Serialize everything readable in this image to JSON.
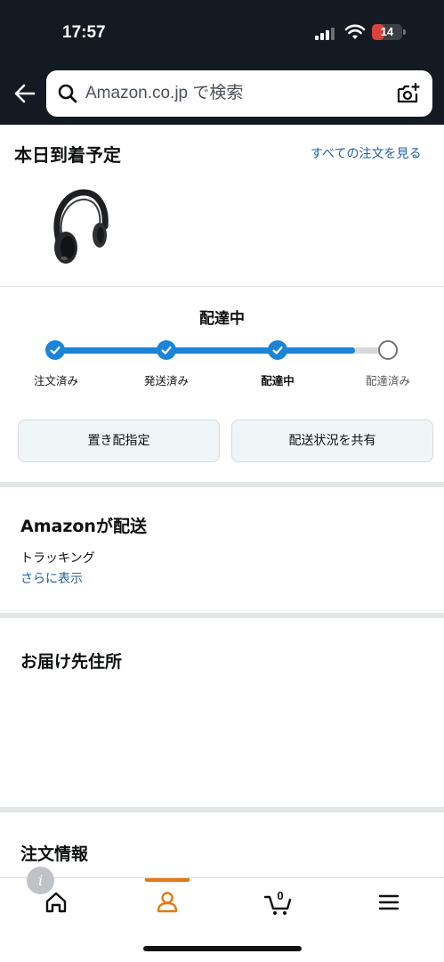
{
  "status_bar": {
    "time": "17:57",
    "battery": "14",
    "battery_level": 0.14
  },
  "search": {
    "placeholder": "Amazon.co.jp で検索",
    "value": "Amazon.co.jp で検索"
  },
  "arrival": {
    "title": "本日到着予定",
    "view_all_link": "すべての注文を見る"
  },
  "product": {
    "image_icon": "headphones-image"
  },
  "tracking": {
    "status": "配達中",
    "progress": 0.9,
    "steps": [
      {
        "label": "注文済み",
        "state": "done"
      },
      {
        "label": "発送済み",
        "state": "done"
      },
      {
        "label": "配達中",
        "state": "current"
      },
      {
        "label": "配達済み",
        "state": "todo"
      }
    ],
    "buttons": {
      "drop_off": "置き配指定",
      "share": "配送状況を共有"
    }
  },
  "carrier": {
    "title": "Amazonが配送",
    "tracking_text": "トラッキング",
    "show_more": "さらに表示"
  },
  "address": {
    "title": "お届け先住所"
  },
  "order_info": {
    "title": "注文情報"
  },
  "bottom_nav": {
    "cart_count": "0",
    "active": "account"
  },
  "colors": {
    "header_bg": "#131a22",
    "accent_blue": "#1a84d8",
    "link_blue": "#2162a1",
    "active_orange": "#e47911"
  }
}
